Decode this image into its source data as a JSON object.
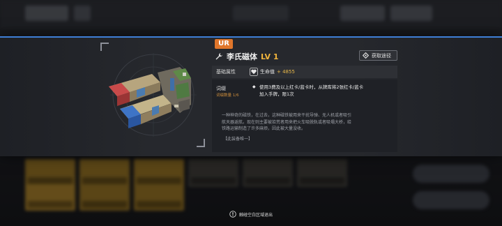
{
  "item": {
    "rarity": "UR",
    "name": "李氏磁体",
    "level": "LV 1",
    "icon": "wrench-icon"
  },
  "header": {
    "source_button": "获取途径",
    "source_icon": "diamond-icon"
  },
  "attributes": {
    "label": "基础属性",
    "hp_label": "生命值",
    "hp_value": "+ 4855",
    "hp_icon": "heart-icon"
  },
  "tag": {
    "label": "词缀",
    "count": "词缀数量 1/6",
    "line1": "使用3费及以上红卡/蓝卡时，从牌库将2张红卡/蓝卡",
    "line2": "加入手牌，限1次"
  },
  "flavor": {
    "line1": "一种神奇的磁铁，在过去，这种磁铁被用来干扰导弹、无人机或者吸引",
    "line2": "航天器返航。现在则主要被拾荒者用来把火车吸脱轨或者吸塌大桥，给",
    "line3": "铁路运输制造了许多麻烦，因此被大量没收。",
    "tagline": "【此装备唯一】"
  },
  "footer": {
    "exit_hint": "触碰空白区域退出",
    "hint_icon": "tap-icon"
  },
  "colors": {
    "accent_blue": "#3f7fd6",
    "rarity_orange": "#e0762b",
    "level_gold": "#f0b43c",
    "value_gold": "#e8b84a"
  }
}
